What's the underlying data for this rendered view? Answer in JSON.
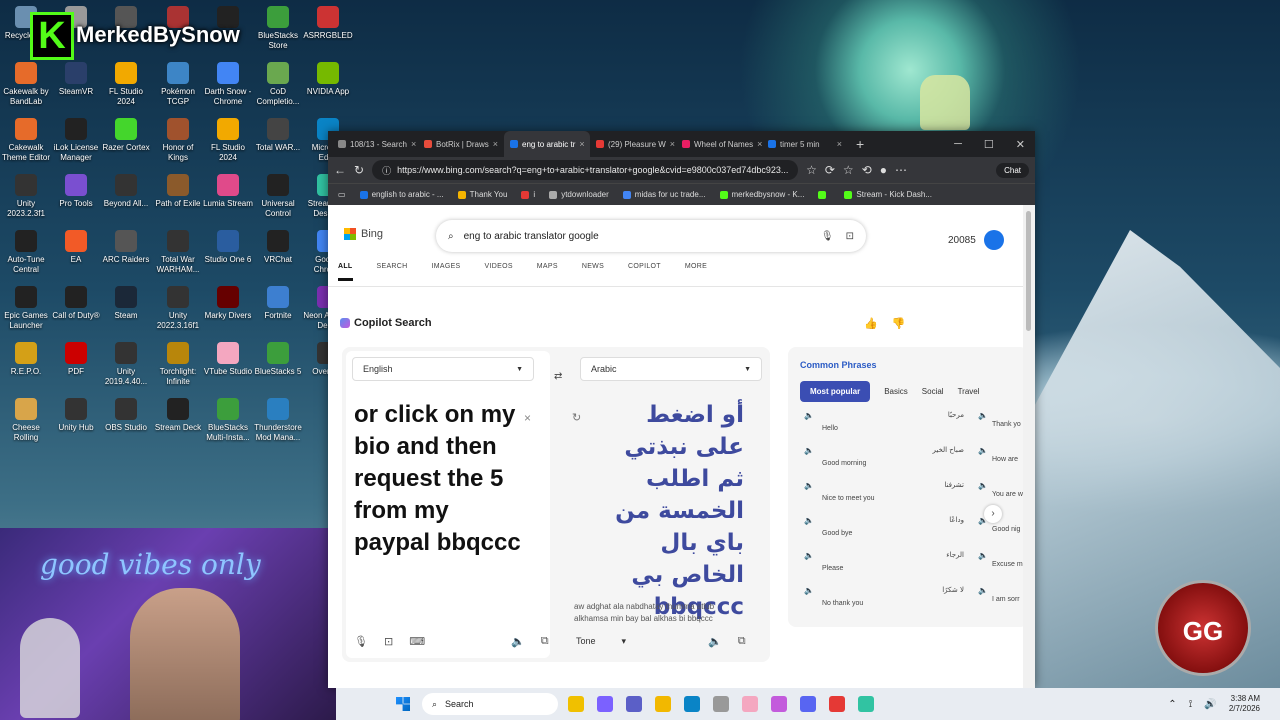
{
  "desktop": {
    "overlay": {
      "logo_letter": "K",
      "name": "MerkedBySnow"
    },
    "icons": [
      {
        "label": "Recycle Bin",
        "color": "#6a8fb0"
      },
      {
        "label": "",
        "color": "#999"
      },
      {
        "label": "",
        "color": "#555"
      },
      {
        "label": "",
        "color": "#a33"
      },
      {
        "label": "",
        "color": "#222"
      },
      {
        "label": "BlueStacks Store",
        "color": "#3c9e3c"
      },
      {
        "label": "ASRRGBLED",
        "color": "#c33"
      },
      {
        "label": "Cakewalk by BandLab",
        "color": "#e66b2a"
      },
      {
        "label": "SteamVR",
        "color": "#2a3f6a"
      },
      {
        "label": "FL Studio 2024",
        "color": "#f2a900"
      },
      {
        "label": "Pokémon TCGP",
        "color": "#3d85c6"
      },
      {
        "label": "Darth Snow - Chrome",
        "color": "#4285f4"
      },
      {
        "label": "CoD Completio...",
        "color": "#6aa84f"
      },
      {
        "label": "NVIDIA App",
        "color": "#76b900"
      },
      {
        "label": "Cakewalk Theme Editor",
        "color": "#e66b2a"
      },
      {
        "label": "iLok License Manager",
        "color": "#222"
      },
      {
        "label": "Razer Cortex",
        "color": "#44d62c"
      },
      {
        "label": "Honor of Kings",
        "color": "#a0522d"
      },
      {
        "label": "FL Studio 2024",
        "color": "#f2a900"
      },
      {
        "label": "Total WAR...",
        "color": "#444"
      },
      {
        "label": "Microsoft Edge",
        "color": "#0a84c6"
      },
      {
        "label": "Unity 2023.2.3f1",
        "color": "#333"
      },
      {
        "label": "Pro Tools",
        "color": "#7a4fd0"
      },
      {
        "label": "Beyond All...",
        "color": "#333"
      },
      {
        "label": "Path of Exile",
        "color": "#8b5a2b"
      },
      {
        "label": "Lumia Stream",
        "color": "#e04a8a"
      },
      {
        "label": "Universal Control",
        "color": "#222"
      },
      {
        "label": "Streamlabs Desktop",
        "color": "#31c3a2"
      },
      {
        "label": "Auto-Tune Central",
        "color": "#222"
      },
      {
        "label": "EA",
        "color": "#f25a27"
      },
      {
        "label": "ARC Raiders",
        "color": "#555"
      },
      {
        "label": "Total War WARHAM...",
        "color": "#333"
      },
      {
        "label": "Studio One 6",
        "color": "#2a5d9f"
      },
      {
        "label": "VRChat",
        "color": "#222"
      },
      {
        "label": "Google Chrome",
        "color": "#4285f4"
      },
      {
        "label": "Epic Games Launcher",
        "color": "#222"
      },
      {
        "label": "Call of Duty®",
        "color": "#222"
      },
      {
        "label": "Steam",
        "color": "#1b2838"
      },
      {
        "label": "Unity 2022.3.16f1",
        "color": "#333"
      },
      {
        "label": "Marky Divers",
        "color": "#600"
      },
      {
        "label": "Fortnite",
        "color": "#3d7fd0"
      },
      {
        "label": "Neon Abyss 2 Demo",
        "color": "#7b2fb0"
      },
      {
        "label": "R.E.P.O.",
        "color": "#d4a017"
      },
      {
        "label": "PDF",
        "color": "#c00"
      },
      {
        "label": "Unity 2019.4.40...",
        "color": "#333"
      },
      {
        "label": "Torchlight: Infinite",
        "color": "#b8860b"
      },
      {
        "label": "VTube Studio",
        "color": "#f4a7c0"
      },
      {
        "label": "BlueStacks 5",
        "color": "#3c9e3c"
      },
      {
        "label": "Overwolf",
        "color": "#333"
      },
      {
        "label": "Cheese Rolling",
        "color": "#d8a54a"
      },
      {
        "label": "Unity Hub",
        "color": "#333"
      },
      {
        "label": "OBS Studio",
        "color": "#333"
      },
      {
        "label": "Stream Deck",
        "color": "#222"
      },
      {
        "label": "BlueStacks Multi-Insta...",
        "color": "#3c9e3c"
      },
      {
        "label": "Thunderstore Mod Mana...",
        "color": "#2a7fc0"
      }
    ],
    "webcam_sign": "good vibes only",
    "badge_text": "GG"
  },
  "browser": {
    "tabs": [
      {
        "label": "108/13 - Search",
        "color": "#888",
        "active": false
      },
      {
        "label": "BotRix | Draws",
        "color": "#e74c3c",
        "active": false
      },
      {
        "label": "eng to arabic tr",
        "color": "#1a73e8",
        "active": true
      },
      {
        "label": "(29) Pleasure W",
        "color": "#e53935",
        "active": false
      },
      {
        "label": "Wheel of Names",
        "color": "#e91e63",
        "active": false
      },
      {
        "label": "timer 5 min",
        "color": "#1a73e8",
        "active": false
      }
    ],
    "url": "https://www.bing.com/search?q=eng+to+arabic+translator+google&cvid=e9800c037ed74dbc923...",
    "chat_label": "Chat",
    "favorites": [
      {
        "label": "english to arabic - ...",
        "color": "#1a73e8"
      },
      {
        "label": "Thank You",
        "color": "#f4b400"
      },
      {
        "label": "i",
        "color": "#e53935"
      },
      {
        "label": "ytdownloader",
        "color": "#aaa"
      },
      {
        "label": "midas for uc trade...",
        "color": "#4285f4"
      },
      {
        "label": "merkedbysnow - K...",
        "color": "#53fc18"
      },
      {
        "label": "",
        "color": "#53fc18"
      },
      {
        "label": "Stream - Kick Dash...",
        "color": "#53fc18"
      }
    ]
  },
  "bing": {
    "logo": "Bing",
    "query": "eng to arabic translator google",
    "points": "20085",
    "nav": [
      "ALL",
      "SEARCH",
      "IMAGES",
      "VIDEOS",
      "MAPS",
      "NEWS",
      "COPILOT",
      "MORE"
    ],
    "copilot_title": "Copilot Search",
    "translator": {
      "source_lang": "English",
      "target_lang": "Arabic",
      "source_text": "or click on my bio and then request the 5 from my paypal bbqccc",
      "target_text": "أو اضغط على نبذتي ثم اطلب الخمسة من باي بال الخاص بي bbqccc",
      "transliteration": "aw adghat ala nabdhatay thumma atlub alkhamsa min bay bal alkhas bi bbqccc",
      "tone_label": "Tone"
    },
    "phrases": {
      "title": "Common Phrases",
      "tabs": [
        "Most popular",
        "Basics",
        "Social",
        "Travel"
      ],
      "rows": [
        {
          "en": "Hello",
          "ar": "مرحبًا",
          "en2": "Thank yo"
        },
        {
          "en": "Good morning",
          "ar": "صباح الخير",
          "en2": "How are"
        },
        {
          "en": "Nice to meet you",
          "ar": "تشرفنا",
          "en2": "You are w"
        },
        {
          "en": "Good bye",
          "ar": "وداعًا",
          "en2": "Good nig"
        },
        {
          "en": "Please",
          "ar": "الرجاء",
          "en2": "Excuse m"
        },
        {
          "en": "No thank you",
          "ar": "لا شكرًا",
          "en2": "I am sorr"
        }
      ]
    }
  },
  "taskbar": {
    "search_label": "Search",
    "apps": [
      "#f0c000",
      "#7b61ff",
      "#5b5fc7",
      "#f2b800",
      "#0a84c6",
      "#999",
      "#f4a7c0",
      "#c35bdc",
      "#5865f2",
      "#e53935",
      "#31c3a2"
    ],
    "time": "3:38 AM",
    "date": "2/7/2026"
  }
}
